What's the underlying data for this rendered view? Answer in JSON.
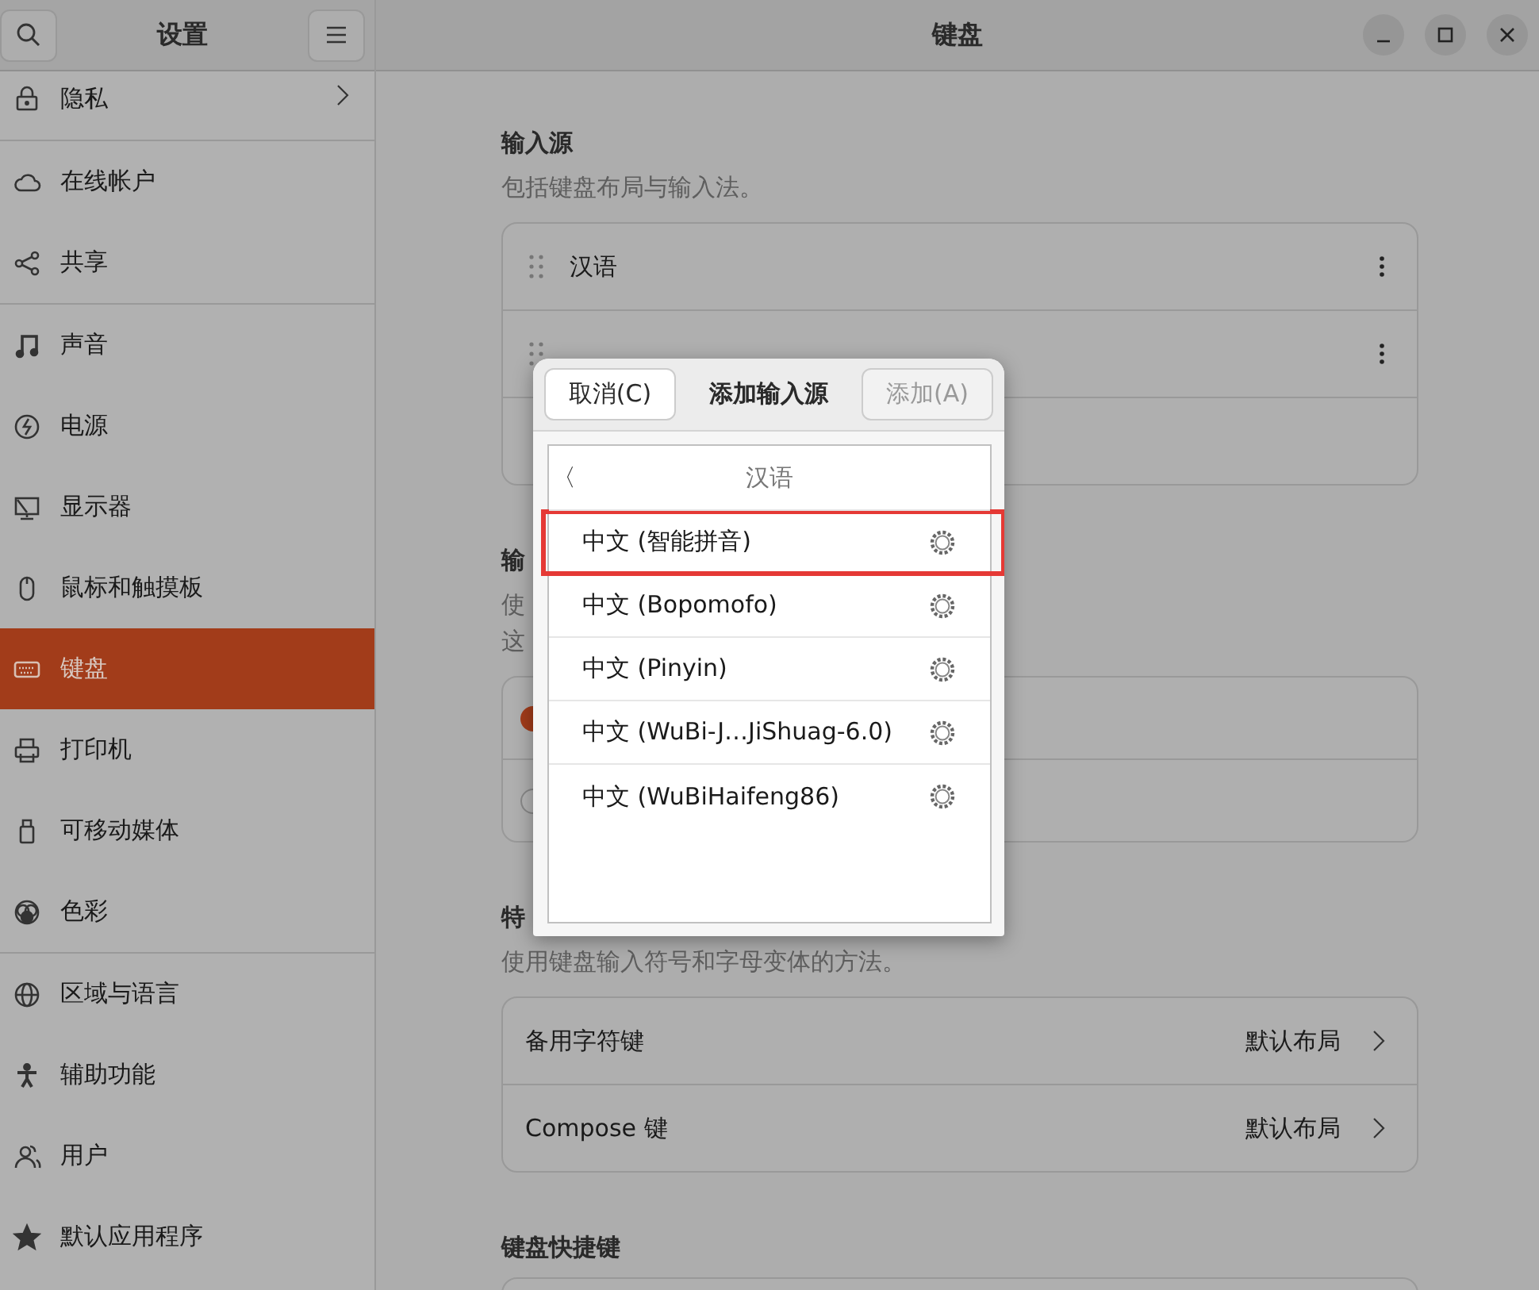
{
  "sidebar": {
    "title": "设置",
    "groups": [
      {
        "items": [
          {
            "label": "隐私",
            "kind": "submenu",
            "selected": false
          }
        ]
      },
      {
        "items": [
          {
            "label": "在线帐户",
            "kind": "page",
            "selected": false
          },
          {
            "label": "共享",
            "kind": "page",
            "selected": false
          }
        ]
      },
      {
        "items": [
          {
            "label": "声音",
            "kind": "page",
            "selected": false
          },
          {
            "label": "电源",
            "kind": "page",
            "selected": false
          },
          {
            "label": "显示器",
            "kind": "page",
            "selected": false
          },
          {
            "label": "鼠标和触摸板",
            "kind": "page",
            "selected": false
          },
          {
            "label": "键盘",
            "kind": "page",
            "selected": true
          },
          {
            "label": "打印机",
            "kind": "page",
            "selected": false
          },
          {
            "label": "可移动媒体",
            "kind": "page",
            "selected": false
          },
          {
            "label": "色彩",
            "kind": "page",
            "selected": false
          }
        ]
      },
      {
        "items": [
          {
            "label": "区域与语言",
            "kind": "page",
            "selected": false
          },
          {
            "label": "辅助功能",
            "kind": "page",
            "selected": false
          },
          {
            "label": "用户",
            "kind": "page",
            "selected": false
          },
          {
            "label": "默认应用程序",
            "kind": "page",
            "selected": false
          }
        ]
      }
    ]
  },
  "main": {
    "title": "键盘",
    "sections": [
      {
        "title": "输入源",
        "description": [
          "包括键盘布局与输入法。"
        ],
        "rows": [
          {
            "kind": "source",
            "label": "汉语"
          },
          {
            "kind": "source"
          },
          {
            "kind": "empty"
          }
        ]
      },
      {
        "title": "输",
        "description": [
          "使",
          "这"
        ],
        "rows": [
          {
            "kind": "radio",
            "selected": true
          },
          {
            "kind": "radio",
            "selected": false
          }
        ]
      },
      {
        "title": "特",
        "description": [
          "使用键盘输入符号和字母变体的方法。"
        ],
        "rows": [
          {
            "kind": "link",
            "label": "备用字符键",
            "value": "默认布局"
          },
          {
            "kind": "link",
            "label": "Compose 键",
            "value": "默认布局"
          }
        ]
      },
      {
        "title": "键盘快捷键",
        "rows": [
          {
            "kind": "empty"
          }
        ]
      }
    ]
  },
  "dialog": {
    "cancel": "取消(C)",
    "title": "添加输入源",
    "add": {
      "label": "添加(A)",
      "disabled": true
    },
    "back": "〈",
    "heading": "汉语",
    "items": [
      {
        "label": "中文 (智能拼音)",
        "highlighted": true
      },
      {
        "label": "中文 (Bopomofo)",
        "highlighted": false
      },
      {
        "label": "中文 (Pinyin)",
        "highlighted": false
      },
      {
        "label": "中文 (WuBi-J…JiShuag-6.0)",
        "highlighted": false
      },
      {
        "label": "中文 (WuBiHaifeng86)",
        "highlighted": false
      }
    ]
  }
}
